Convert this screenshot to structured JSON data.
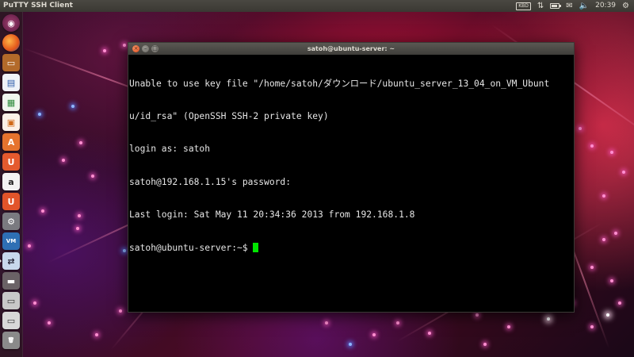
{
  "top_panel": {
    "app_title": "PuTTY SSH Client",
    "keyboard_label": "KBD",
    "battery_level": 0.8,
    "clock": "20:39"
  },
  "launcher": {
    "items": [
      {
        "name": "dash-icon",
        "glyph": "◉",
        "active": false
      },
      {
        "name": "firefox-icon",
        "glyph": "",
        "active": false
      },
      {
        "name": "files-icon",
        "glyph": "▭",
        "active": false
      },
      {
        "name": "writer-icon",
        "glyph": "▤",
        "active": false
      },
      {
        "name": "calc-icon",
        "glyph": "▦",
        "active": false
      },
      {
        "name": "impress-icon",
        "glyph": "▣",
        "active": false
      },
      {
        "name": "software-center-icon",
        "glyph": "A",
        "active": false
      },
      {
        "name": "ubuntu-one-icon",
        "glyph": "U",
        "active": false
      },
      {
        "name": "amazon-icon",
        "glyph": "a",
        "active": false
      },
      {
        "name": "update-manager-icon",
        "glyph": "U",
        "active": false
      },
      {
        "name": "settings-icon",
        "glyph": "⚙",
        "active": false
      },
      {
        "name": "virtual-machine-icon",
        "glyph": "VM",
        "active": false
      },
      {
        "name": "putty-icon",
        "glyph": "⇄",
        "active": true
      },
      {
        "name": "folder-icon",
        "glyph": "▬",
        "active": false
      },
      {
        "name": "drive-icon",
        "glyph": "▭",
        "active": false
      },
      {
        "name": "removable-drive-icon",
        "glyph": "▭",
        "active": false
      },
      {
        "name": "trash-icon",
        "glyph": "🗑",
        "active": false
      }
    ]
  },
  "window": {
    "title": "satoh@ubuntu-server: ~",
    "close_glyph": "×",
    "min_glyph": "–",
    "max_glyph": "□"
  },
  "terminal": {
    "lines": [
      "Unable to use key file \"/home/satoh/ダウンロード/ubuntu_server_13_04_on_VM_Ubunt",
      "u/id_rsa\" (OpenSSH SSH-2 private key)",
      "login as: satoh",
      "satoh@192.168.1.15's password:",
      "Last login: Sat May 11 20:34:36 2013 from 192.168.1.8"
    ],
    "prompt": "satoh@ubuntu-server:~$ "
  }
}
